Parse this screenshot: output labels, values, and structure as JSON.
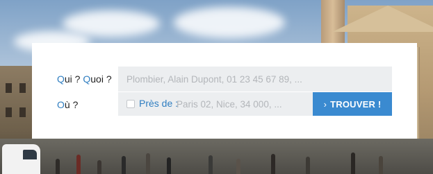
{
  "search": {
    "who_label_q1": "Q",
    "who_label_rest1": "ui ? ",
    "who_label_q2": "Q",
    "who_label_rest2": "uoi ?",
    "who_placeholder": "Plombier, Alain Dupont, 01 23 45 67 89, ...",
    "where_label_q": "O",
    "where_label_rest": "ù ?",
    "near_checkbox_label": "Près de :",
    "where_placeholder": "Paris 02, Nice, 34 000, ...",
    "submit_icon": "›",
    "submit_label": "TROUVER !"
  },
  "colors": {
    "accent": "#2f7ec1",
    "button": "#3a8ad0",
    "input_bg": "#eceef0"
  }
}
